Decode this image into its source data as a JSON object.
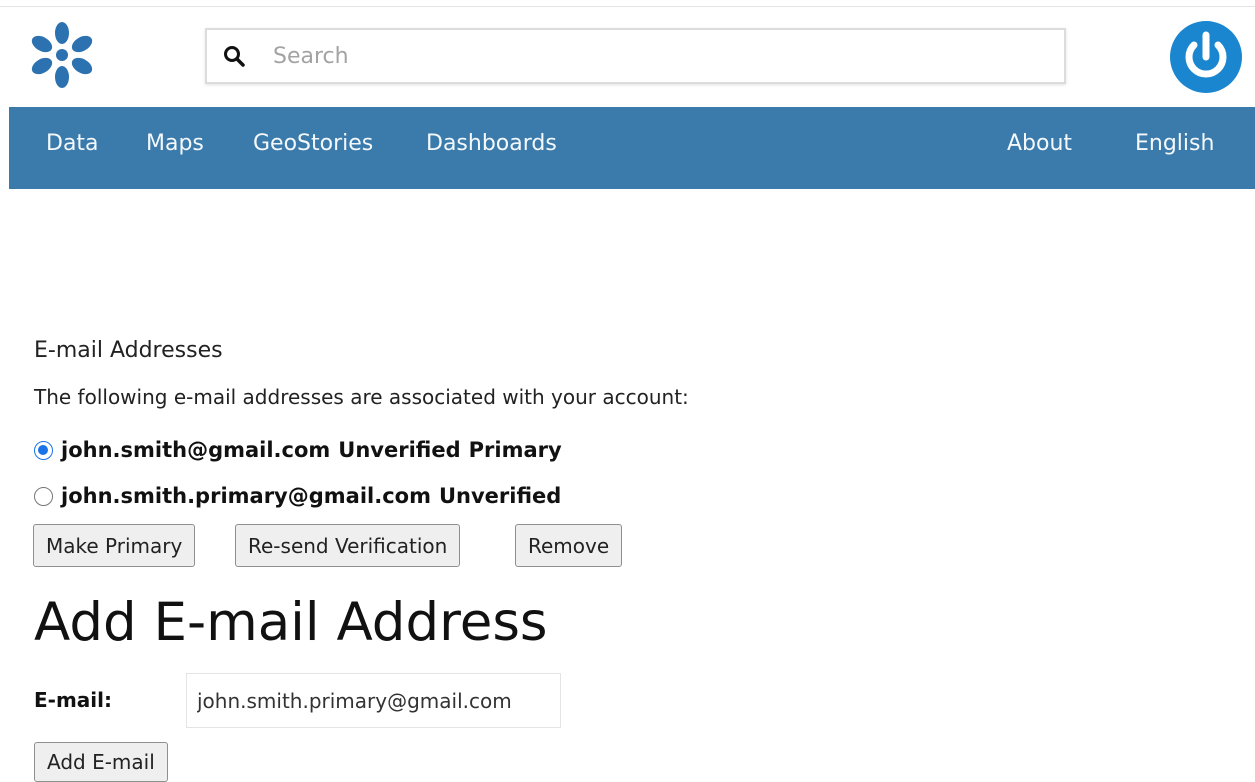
{
  "header": {
    "logo_icon": "asterisk-flower-logo",
    "search": {
      "placeholder": "Search",
      "value": ""
    },
    "power_icon": "power-icon"
  },
  "nav": {
    "left": [
      {
        "label": "Data"
      },
      {
        "label": "Maps"
      },
      {
        "label": "GeoStories"
      },
      {
        "label": "Dashboards"
      }
    ],
    "right": [
      {
        "label": "About"
      },
      {
        "label": "English"
      }
    ],
    "color": "#3b7bab"
  },
  "emails_section": {
    "title": "E-mail Addresses",
    "description": "The following e-mail addresses are associated with your account:",
    "addresses": [
      {
        "email": "john.smith@gmail.com",
        "status": "Unverified",
        "primary": "Primary",
        "checked": true
      },
      {
        "email": "john.smith.primary@gmail.com",
        "status": "Unverified",
        "primary": "",
        "checked": false
      }
    ],
    "buttons": {
      "make_primary": "Make Primary",
      "resend": "Re-send Verification",
      "remove": "Remove"
    }
  },
  "add_section": {
    "title": "Add E-mail Address",
    "email_label": "E-mail:",
    "email_value": "john.smith.primary@gmail.com",
    "add_button": "Add E-mail"
  },
  "colors": {
    "brand_blue": "#3b7bab",
    "logo_blue": "#2c71b0",
    "power_blue": "#1a86d0"
  }
}
